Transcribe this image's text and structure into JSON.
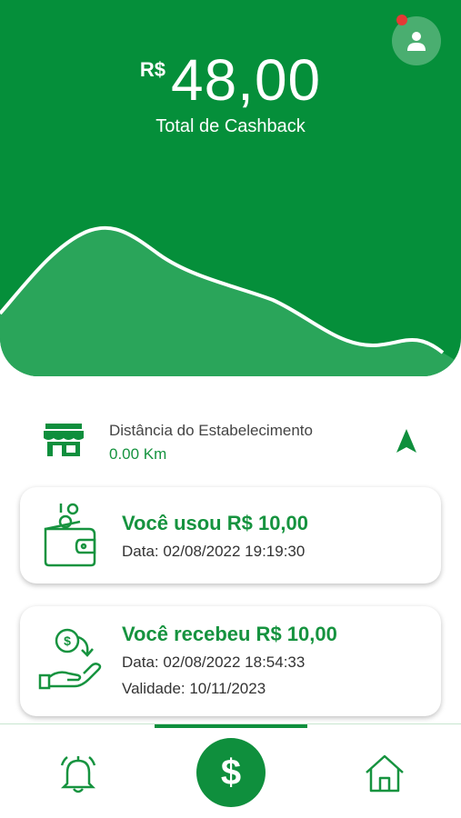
{
  "header": {
    "currency_symbol": "R$",
    "cashback_amount": "48,00",
    "cashback_label": "Total de Cashback",
    "has_notification": true
  },
  "distance": {
    "label": "Distância do Estabelecimento",
    "value": "0.00 Km"
  },
  "transactions": [
    {
      "title": "Você usou R$ 10,00",
      "date_line": "Data: 02/08/2022 19:19:30",
      "icon": "wallet-coins-icon"
    },
    {
      "title": "Você recebeu R$ 10,00",
      "date_line": "Data: 02/08/2022 18:54:33",
      "validity_line": "Validade: 10/11/2023",
      "icon": "hand-receive-money-icon"
    }
  ],
  "bottom_nav": {
    "items": [
      {
        "icon": "bell-icon"
      },
      {
        "icon": "dollar-icon",
        "label": "$",
        "active": true
      },
      {
        "icon": "home-icon"
      }
    ]
  },
  "colors": {
    "brand_green": "#058f3a",
    "accent_green": "#16933f",
    "notification_red": "#e53935"
  }
}
